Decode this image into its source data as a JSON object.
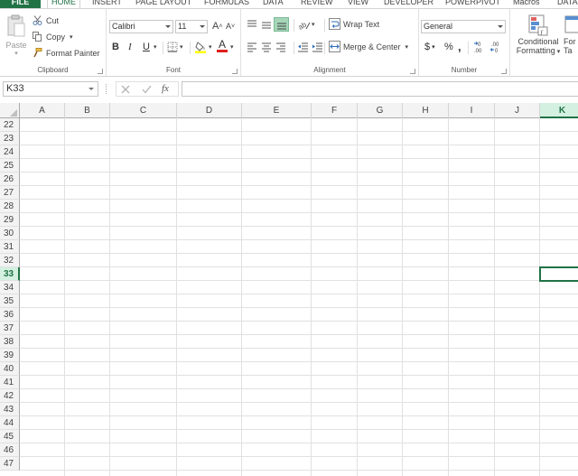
{
  "tabs": [
    {
      "label": "FILE"
    },
    {
      "label": "HOME"
    },
    {
      "label": "INSERT"
    },
    {
      "label": "PAGE LAYOUT"
    },
    {
      "label": "FORMULAS"
    },
    {
      "label": "DATA"
    },
    {
      "label": "REVIEW"
    },
    {
      "label": "VIEW"
    },
    {
      "label": "DEVELOPER"
    },
    {
      "label": "POWERPIVOT"
    },
    {
      "label": "Macros"
    },
    {
      "label": "DATA"
    }
  ],
  "clipboard": {
    "paste": "Paste",
    "cut": "Cut",
    "copy": "Copy",
    "format_painter": "Format Painter",
    "label": "Clipboard"
  },
  "font": {
    "name": "Calibri",
    "size": "11",
    "grow": "A",
    "shrink": "A",
    "bold": "B",
    "italic": "I",
    "underline": "U",
    "font_color_letter": "A",
    "label": "Font"
  },
  "alignment": {
    "wrap_text": "Wrap Text",
    "merge_center": "Merge & Center",
    "label": "Alignment"
  },
  "number": {
    "format": "General",
    "currency": "$",
    "percent": "%",
    "comma": ",",
    "label": "Number"
  },
  "styles": {
    "conditional_line1": "Conditional",
    "conditional_line2": "Formatting",
    "format_table_line1": "For",
    "format_table_line2": "Ta"
  },
  "formula_bar": {
    "name_box": "K33",
    "fx": "fx",
    "value": ""
  },
  "grid": {
    "columns": [
      "A",
      "B",
      "C",
      "D",
      "E",
      "F",
      "G",
      "H",
      "I",
      "J",
      "K"
    ],
    "rows": [
      "22",
      "23",
      "24",
      "25",
      "26",
      "27",
      "28",
      "29",
      "30",
      "31",
      "32",
      "33",
      "34",
      "35",
      "36",
      "37",
      "38",
      "39",
      "40",
      "41",
      "42",
      "43",
      "44",
      "45",
      "46",
      "47"
    ],
    "selected_cell": "K33",
    "selected_column": "K",
    "selected_row": "33"
  },
  "colors": {
    "accent": "#217346",
    "selection_header": "#d3f0e0",
    "gridline": "#e1e1e1"
  }
}
